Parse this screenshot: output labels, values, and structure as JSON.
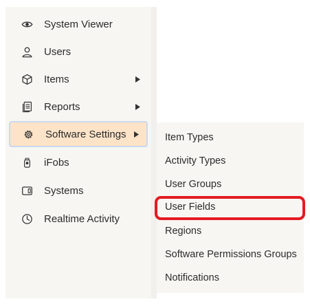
{
  "menu": {
    "items": [
      {
        "label": "System Viewer",
        "icon": "eye-icon",
        "has_submenu": false
      },
      {
        "label": "Users",
        "icon": "user-icon",
        "has_submenu": false
      },
      {
        "label": "Items",
        "icon": "cube-icon",
        "has_submenu": true
      },
      {
        "label": "Reports",
        "icon": "report-icon",
        "has_submenu": true
      },
      {
        "label": "Software Settings",
        "icon": "gear-icon",
        "has_submenu": true,
        "active": true
      },
      {
        "label": "iFobs",
        "icon": "fob-icon",
        "has_submenu": false
      },
      {
        "label": "Systems",
        "icon": "system-icon",
        "has_submenu": false
      },
      {
        "label": "Realtime Activity",
        "icon": "clock-icon",
        "has_submenu": false
      }
    ]
  },
  "submenu": {
    "parent": "Software Settings",
    "items": [
      {
        "label": "Item Types"
      },
      {
        "label": "Activity Types"
      },
      {
        "label": "User Groups"
      },
      {
        "label": "User Fields",
        "highlighted": true
      },
      {
        "label": "Regions"
      },
      {
        "label": "Software Permissions Groups"
      },
      {
        "label": "Notifications"
      }
    ]
  },
  "colors": {
    "active_bg": "#fde3c8",
    "active_border": "#c9d9ee",
    "highlight": "#e31b23",
    "menu_bg": "#f7f6f3"
  }
}
